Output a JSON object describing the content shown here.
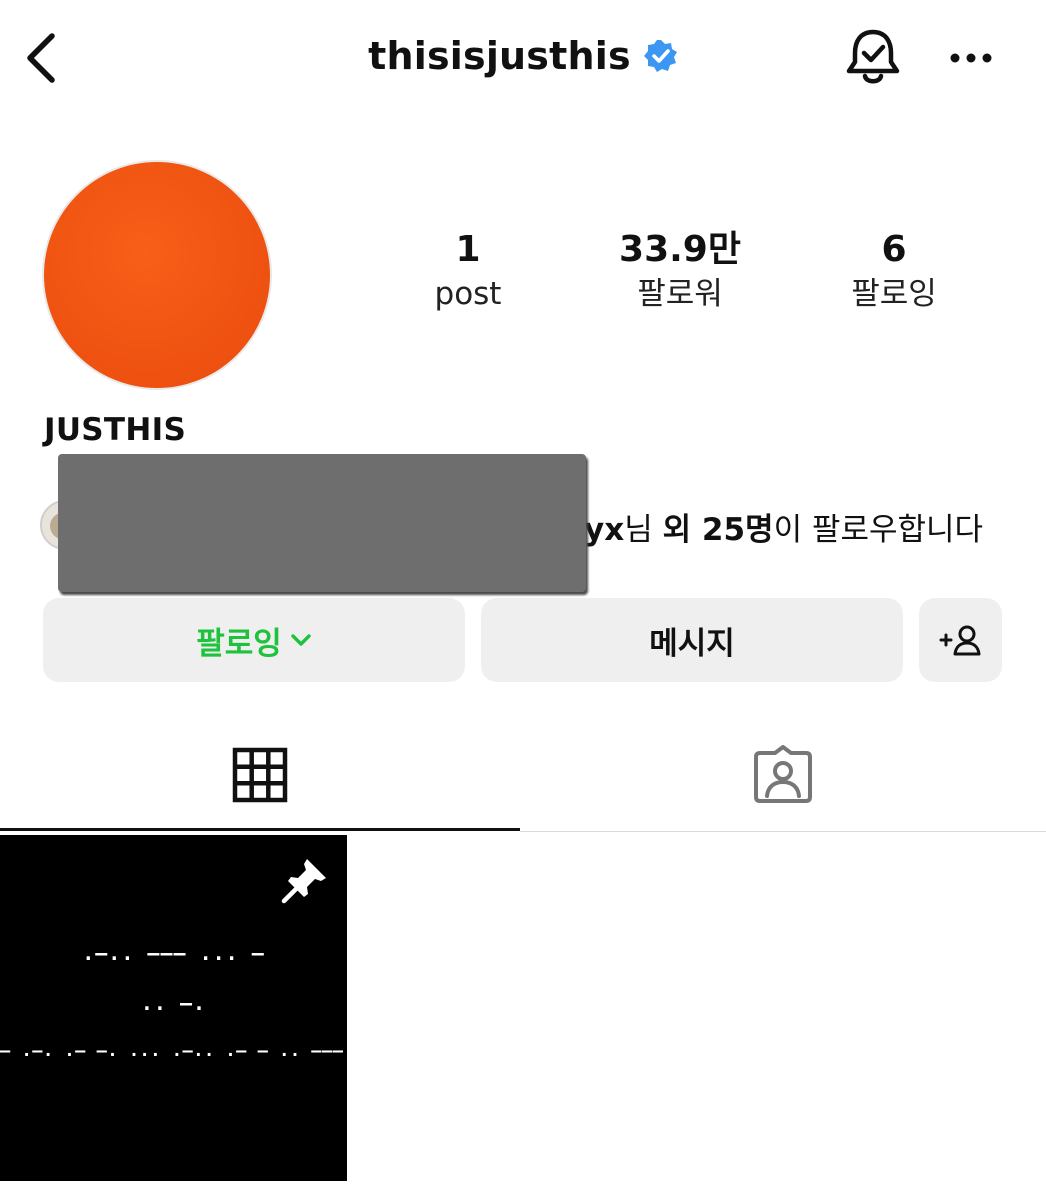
{
  "header": {
    "username": "thisisjusthis",
    "verified": true,
    "icons": [
      "back-icon",
      "verified-badge-icon",
      "bell-icon",
      "more-icon"
    ]
  },
  "profile": {
    "display_name": "JUSTHIS",
    "avatar_color": "#f0540f",
    "stats": {
      "posts": {
        "value": "1",
        "label": "post"
      },
      "followers": {
        "value": "33.9만",
        "label": "팔로워"
      },
      "following": {
        "value": "6",
        "label": "팔로잉"
      }
    },
    "followed_by": {
      "visible_name_fragment": "yx",
      "suffix1": "님 ",
      "other_count": "외 25명",
      "suffix2": "이 팔로우합니다"
    }
  },
  "actions": {
    "following_label": "팔로잉",
    "message_label": "메시지",
    "add_icon": "add-person-icon",
    "following_color": "#1ec23d"
  },
  "tabs": [
    {
      "name": "grid",
      "icon": "grid-icon",
      "active": true
    },
    {
      "name": "tagged",
      "icon": "tagged-icon",
      "active": false
    }
  ],
  "posts": [
    {
      "pinned": true,
      "lines": [
        ".–.. ––– ... –",
        ".. –.",
        "– .–. .– –. ... .–.. .– – .. ––– –."
      ]
    }
  ]
}
